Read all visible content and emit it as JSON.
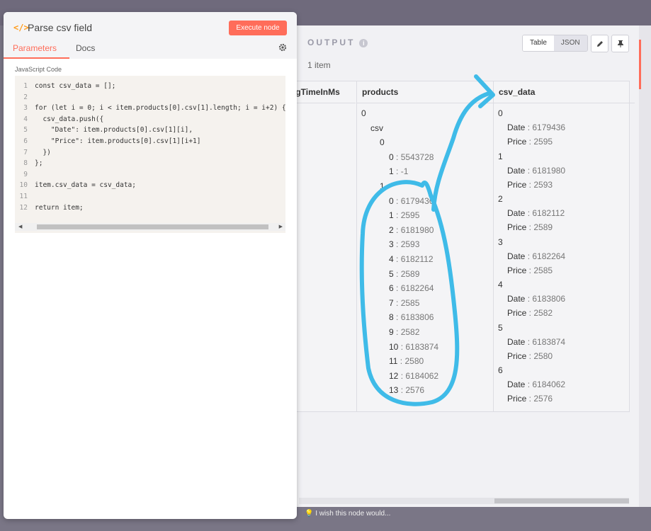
{
  "node": {
    "title": "Parse csv field",
    "execute_label": "Execute node",
    "tabs": [
      "Parameters",
      "Docs"
    ],
    "field_label": "JavaScript Code",
    "code_lines": [
      {
        "n": "1",
        "text": "const csv_data = [];"
      },
      {
        "n": "2",
        "text": ""
      },
      {
        "n": "3",
        "text": "for (let i = 0; i < item.products[0].csv[1].length; i = i+2) {"
      },
      {
        "n": "4",
        "text": "  csv_data.push({"
      },
      {
        "n": "5",
        "text": "    \"Date\": item.products[0].csv[1][i],"
      },
      {
        "n": "6",
        "text": "    \"Price\": item.products[0].csv[1][i+1]"
      },
      {
        "n": "7",
        "text": "  })"
      },
      {
        "n": "8",
        "text": "};"
      },
      {
        "n": "9",
        "text": ""
      },
      {
        "n": "10",
        "text": "item.csv_data = csv_data;"
      },
      {
        "n": "11",
        "text": ""
      },
      {
        "n": "12",
        "text": "return item;"
      }
    ]
  },
  "output": {
    "title": "OUTPUT",
    "item_count": "1 item",
    "view_options": [
      "Table",
      "JSON"
    ],
    "columns": [
      "ngTimeInMs",
      "products",
      "csv_data"
    ],
    "products_tree": [
      {
        "indent": 0,
        "label": "0"
      },
      {
        "indent": 1,
        "label": "csv"
      },
      {
        "indent": 2,
        "label": "0"
      },
      {
        "indent": 3,
        "label": "0",
        "value": "5543728"
      },
      {
        "indent": 3,
        "label": "1",
        "value": "-1"
      },
      {
        "indent": 2,
        "label": "1"
      },
      {
        "indent": 3,
        "label": "0",
        "value": "6179436"
      },
      {
        "indent": 3,
        "label": "1",
        "value": "2595"
      },
      {
        "indent": 3,
        "label": "2",
        "value": "6181980"
      },
      {
        "indent": 3,
        "label": "3",
        "value": "2593"
      },
      {
        "indent": 3,
        "label": "4",
        "value": "6182112"
      },
      {
        "indent": 3,
        "label": "5",
        "value": "2589"
      },
      {
        "indent": 3,
        "label": "6",
        "value": "6182264"
      },
      {
        "indent": 3,
        "label": "7",
        "value": "2585"
      },
      {
        "indent": 3,
        "label": "8",
        "value": "6183806"
      },
      {
        "indent": 3,
        "label": "9",
        "value": "2582"
      },
      {
        "indent": 3,
        "label": "10",
        "value": "6183874"
      },
      {
        "indent": 3,
        "label": "11",
        "value": "2580"
      },
      {
        "indent": 3,
        "label": "12",
        "value": "6184062"
      },
      {
        "indent": 3,
        "label": "13",
        "value": "2576"
      }
    ],
    "csv_data": [
      {
        "index": "0",
        "date": "6179436",
        "price": "2595"
      },
      {
        "index": "1",
        "date": "6181980",
        "price": "2593"
      },
      {
        "index": "2",
        "date": "6182112",
        "price": "2589"
      },
      {
        "index": "3",
        "date": "6182264",
        "price": "2585"
      },
      {
        "index": "4",
        "date": "6183806",
        "price": "2582"
      },
      {
        "index": "5",
        "date": "6183874",
        "price": "2580"
      },
      {
        "index": "6",
        "date": "6184062",
        "price": "2576"
      }
    ],
    "field_labels": {
      "date": "Date",
      "price": "Price"
    }
  },
  "feedback_text": "I wish this node would...",
  "colors": {
    "accent": "#ff6d5a",
    "annotation": "#3fbbe8",
    "code_icon": "#ff9b1a"
  }
}
